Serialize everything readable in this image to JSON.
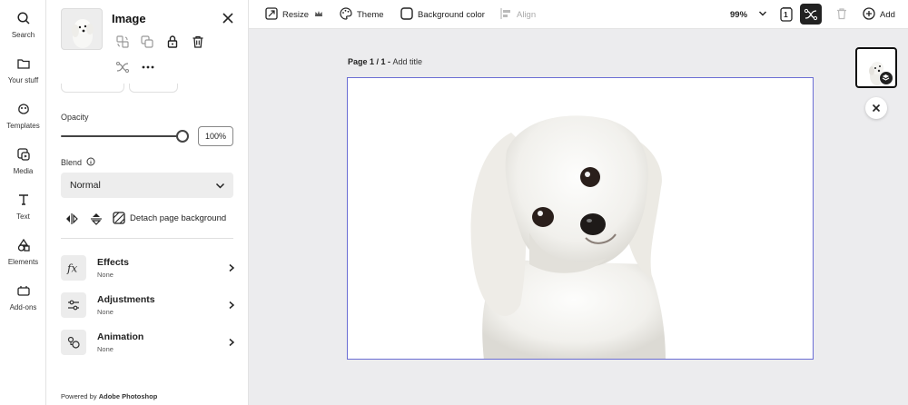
{
  "rail": {
    "items": [
      {
        "label": "Search",
        "icon": "search-icon"
      },
      {
        "label": "Your stuff",
        "icon": "folder-icon"
      },
      {
        "label": "Templates",
        "icon": "templates-icon"
      },
      {
        "label": "Media",
        "icon": "media-icon"
      },
      {
        "label": "Text",
        "icon": "text-icon"
      },
      {
        "label": "Elements",
        "icon": "elements-icon"
      },
      {
        "label": "Add-ons",
        "icon": "addons-icon"
      }
    ]
  },
  "panel": {
    "title": "Image",
    "opacity_label": "Opacity",
    "opacity_value": "100%",
    "opacity_fraction": 1.0,
    "blend_label": "Blend",
    "blend_value": "Normal",
    "detach_label": "Detach page background",
    "rows": [
      {
        "title": "Effects",
        "subtitle": "None",
        "icon": "fx-icon"
      },
      {
        "title": "Adjustments",
        "subtitle": "None",
        "icon": "sliders-icon"
      },
      {
        "title": "Animation",
        "subtitle": "None",
        "icon": "animation-icon"
      }
    ],
    "powered_prefix": "Powered by ",
    "powered_brand": "Adobe Photoshop"
  },
  "toolbar": {
    "resize_label": "Resize",
    "theme_label": "Theme",
    "background_label": "Background color",
    "align_label": "Align",
    "zoom": "99%",
    "page_count": "1",
    "add_label": "Add"
  },
  "canvas": {
    "page_prefix": "Page 1 / 1 - ",
    "add_title": "Add title"
  },
  "colors": {
    "accent": "#6b6ed4",
    "panel_bg": "#ffffff",
    "canvas_bg": "#ececee",
    "active_tool_bg": "#222222"
  }
}
